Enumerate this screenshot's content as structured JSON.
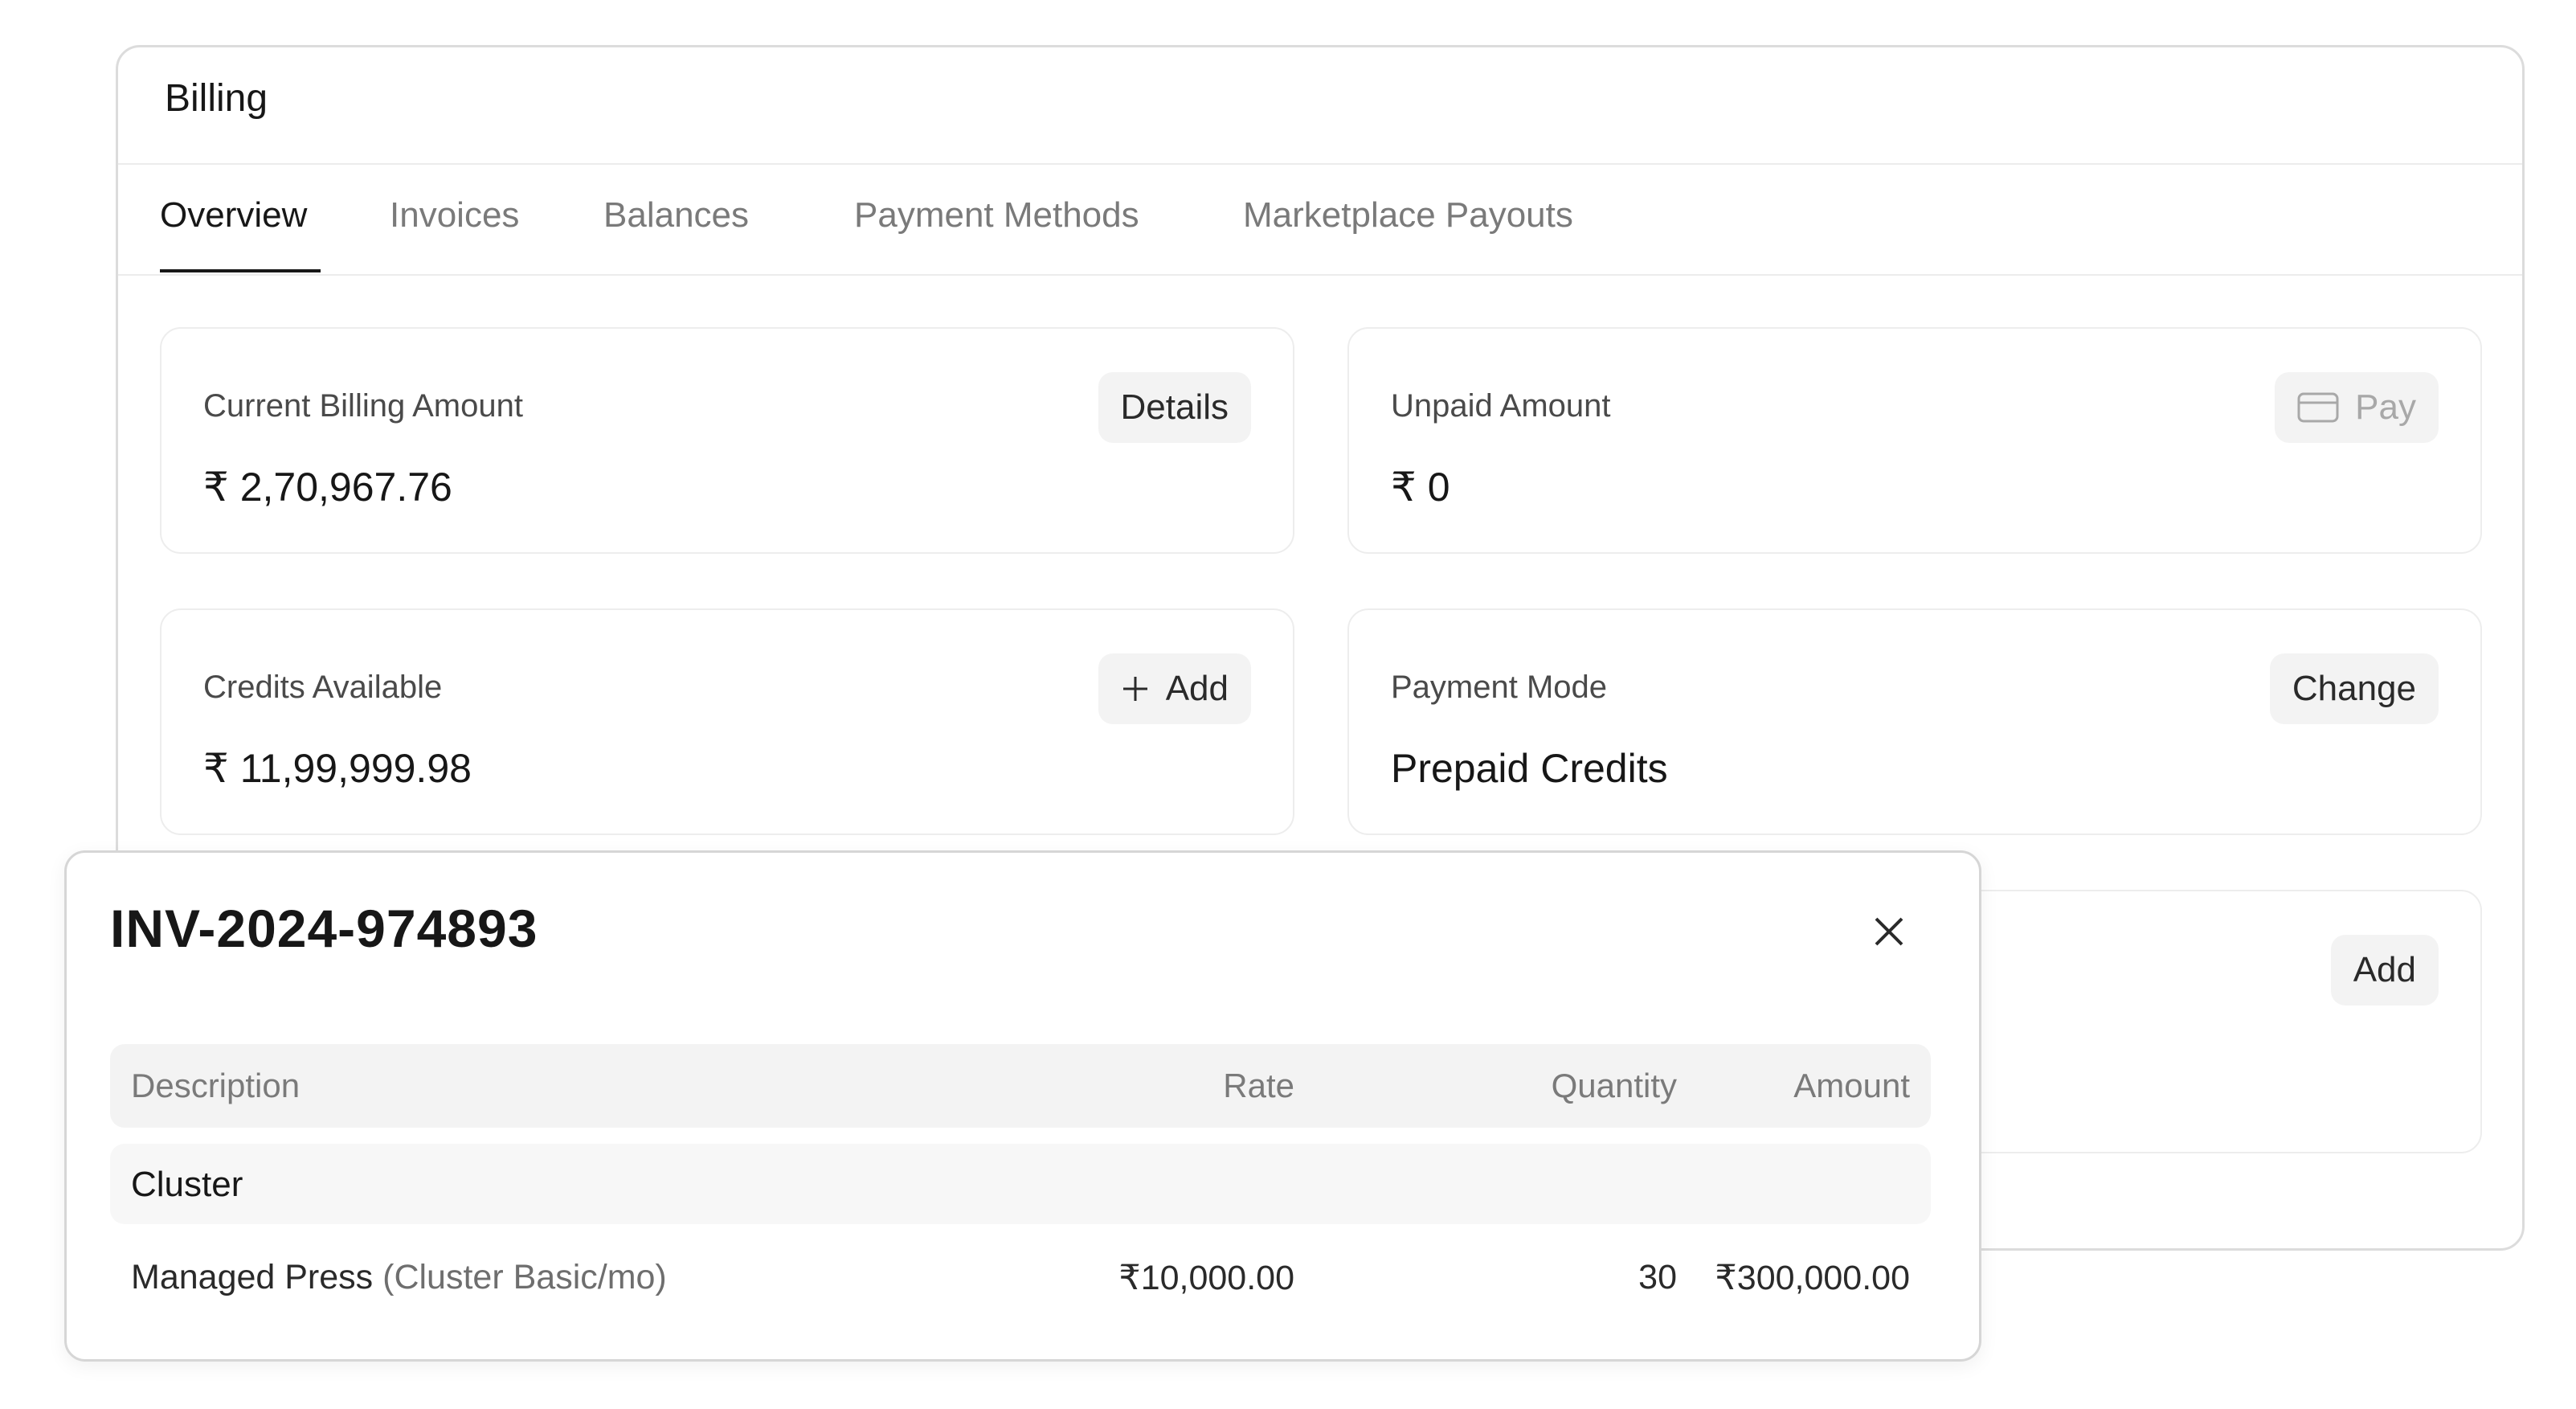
{
  "billing": {
    "title": "Billing",
    "tabs": [
      "Overview",
      "Invoices",
      "Balances",
      "Payment Methods",
      "Marketplace Payouts"
    ],
    "active_tab": "Overview"
  },
  "cards": {
    "current_billing": {
      "label": "Current Billing Amount",
      "value": "₹ 2,70,967.76",
      "button": "Details"
    },
    "unpaid": {
      "label": "Unpaid Amount",
      "value": "₹ 0",
      "button": "Pay",
      "button_icon": "credit-card-icon"
    },
    "credits": {
      "label": "Credits Available",
      "value": "₹ 11,99,999.98",
      "button": "Add",
      "button_icon": "plus-icon"
    },
    "payment_mode": {
      "label": "Payment Mode",
      "value": "Prepaid Credits",
      "button": "Change"
    },
    "partial": {
      "button": "Add"
    }
  },
  "invoice_modal": {
    "title": "INV-2024-974893",
    "columns": [
      "Description",
      "Rate",
      "Quantity",
      "Amount"
    ],
    "group": "Cluster",
    "items": [
      {
        "description": "Managed Press",
        "description_detail": "(Cluster Basic/mo)",
        "rate": "₹10,000.00",
        "quantity": "30",
        "amount": "₹300,000.00"
      }
    ]
  }
}
